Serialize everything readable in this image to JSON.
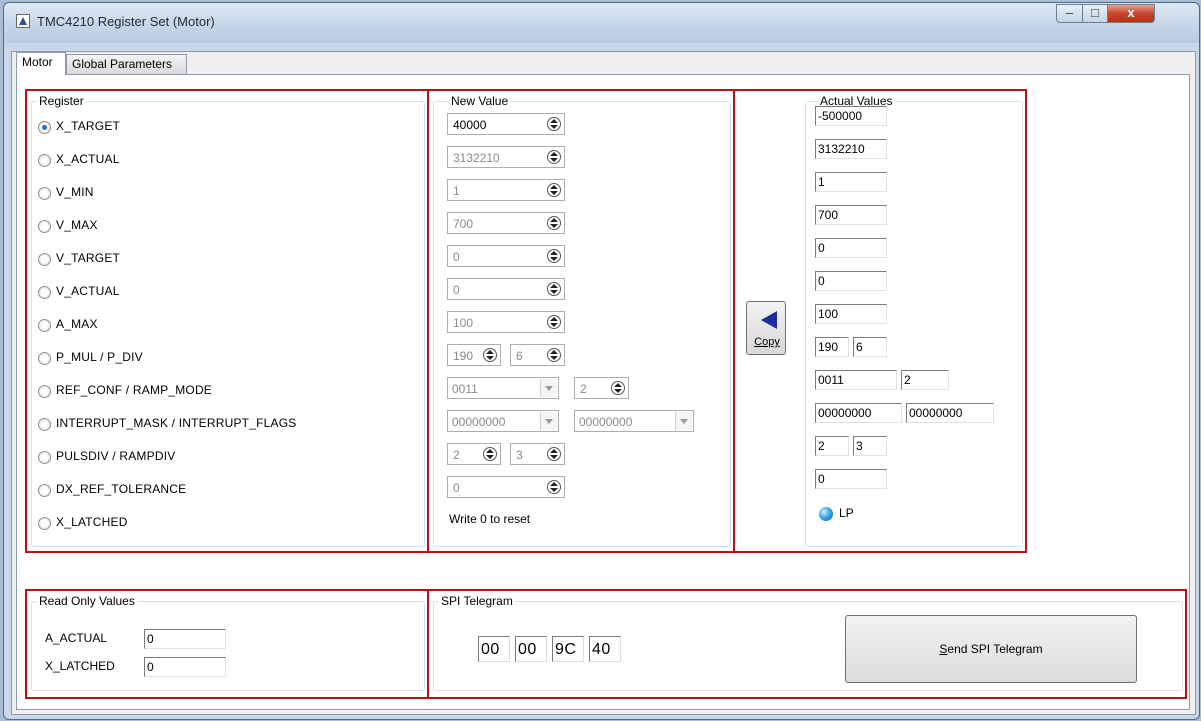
{
  "window": {
    "title": "TMC4210 Register Set (Motor)",
    "controls": {
      "minimize": "–",
      "maximize": "□",
      "close": "x"
    }
  },
  "tabs": [
    {
      "label": "Motor",
      "active": true
    },
    {
      "label": "Global Parameters",
      "active": false
    }
  ],
  "register": {
    "title": "Register",
    "items": [
      {
        "label": "X_TARGET",
        "checked": true
      },
      {
        "label": "X_ACTUAL",
        "checked": false
      },
      {
        "label": "V_MIN",
        "checked": false
      },
      {
        "label": "V_MAX",
        "checked": false
      },
      {
        "label": "V_TARGET",
        "checked": false
      },
      {
        "label": "V_ACTUAL",
        "checked": false
      },
      {
        "label": "A_MAX",
        "checked": false
      },
      {
        "label": "P_MUL / P_DIV",
        "checked": false
      },
      {
        "label": "REF_CONF / RAMP_MODE",
        "checked": false
      },
      {
        "label": "INTERRUPT_MASK / INTERRUPT_FLAGS",
        "checked": false
      },
      {
        "label": "PULSDIV / RAMPDIV",
        "checked": false
      },
      {
        "label": "DX_REF_TOLERANCE",
        "checked": false
      },
      {
        "label": "X_LATCHED",
        "checked": false
      }
    ]
  },
  "new_value": {
    "title": "New Value",
    "x_target": "40000",
    "x_actual": "3132210",
    "v_min": "1",
    "v_max": "700",
    "v_target": "0",
    "v_actual": "0",
    "a_max": "100",
    "p_mul": "190",
    "p_div": "6",
    "ref_conf": "0011",
    "ramp_mode": "2",
    "interrupt_mask": "00000000",
    "interrupt_flags": "00000000",
    "pulsdiv": "2",
    "rampdiv": "3",
    "dx_ref_tolerance": "0",
    "hint": "Write 0 to reset"
  },
  "copy_button": {
    "label": "Copy"
  },
  "actual_values": {
    "title": "Actual Values",
    "x_target": "-500000",
    "x_actual": "3132210",
    "v_min": "1",
    "v_max": "700",
    "v_target": "0",
    "v_actual": "0",
    "a_max": "100",
    "p_mul": "190",
    "p_div": "6",
    "ref_conf": "0011",
    "ramp_mode": "2",
    "interrupt_mask": "00000000",
    "interrupt_flags": "00000000",
    "pulsdiv": "2",
    "rampdiv": "3",
    "dx_ref_tolerance": "0",
    "lp_label": "LP"
  },
  "read_only": {
    "title": "Read Only Values",
    "a_actual_label": "A_ACTUAL",
    "a_actual_value": "0",
    "x_latched_label": "X_LATCHED",
    "x_latched_value": "0"
  },
  "spi": {
    "title": "SPI Telegram",
    "bytes": [
      "00",
      "00",
      "9C",
      "40"
    ],
    "send_first": "S",
    "send_rest": "end SPI Telegram"
  },
  "colors": {
    "highlight_border": "#b31217",
    "led": "#35a8e8",
    "copy_arrow": "#1d2a9a"
  }
}
